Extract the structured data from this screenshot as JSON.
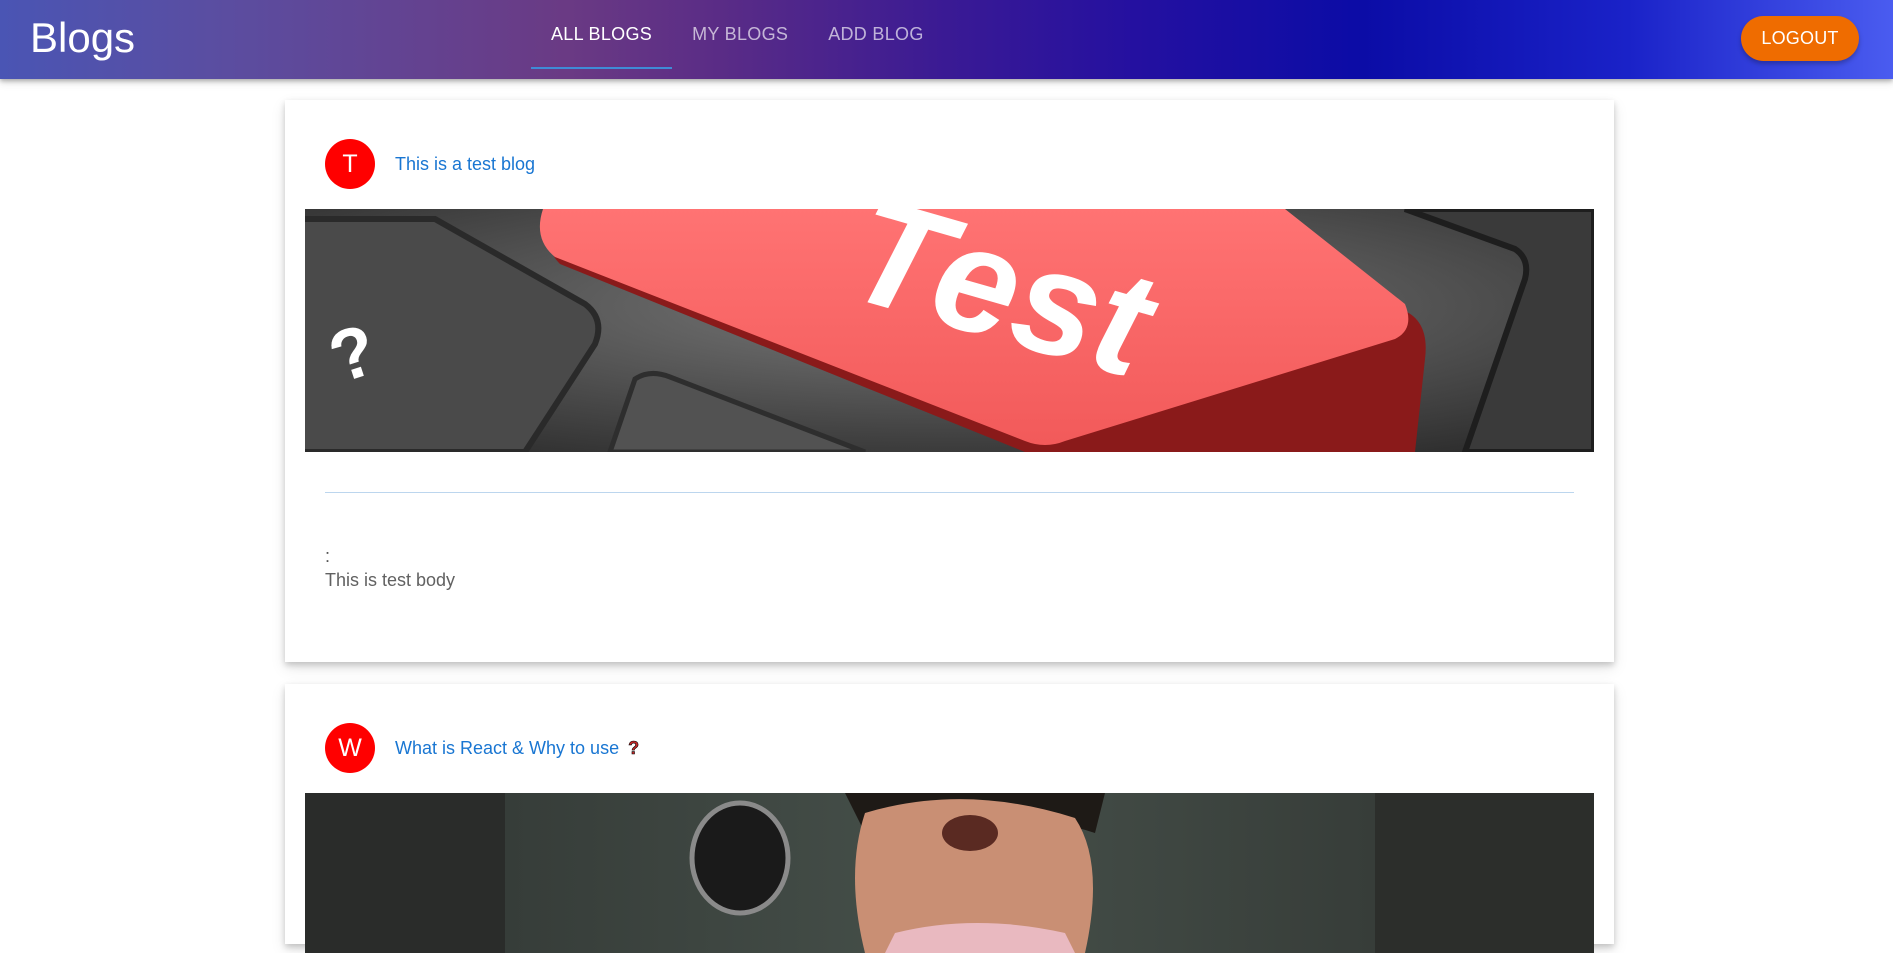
{
  "appbar": {
    "brand": "Blogs",
    "tabs": [
      {
        "label": "All Blogs",
        "active": true
      },
      {
        "label": "My Blogs",
        "active": false
      },
      {
        "label": "Add Blog",
        "active": false
      }
    ],
    "logout_label": "Logout",
    "logout_color": "#ef6c00"
  },
  "posts": [
    {
      "avatar_letter": "T",
      "title": "This is a test blog",
      "image_key_text": "Test",
      "image_question": "?",
      "separator": ":",
      "body": "This is test body"
    },
    {
      "avatar_letter": "W",
      "title": "What is React & Why to use",
      "title_icon": "question-mark-icon"
    }
  ],
  "colors": {
    "avatar": "#ff0000",
    "title_link": "#1976d2",
    "active_tab_indicator": "#3f8bd6"
  }
}
